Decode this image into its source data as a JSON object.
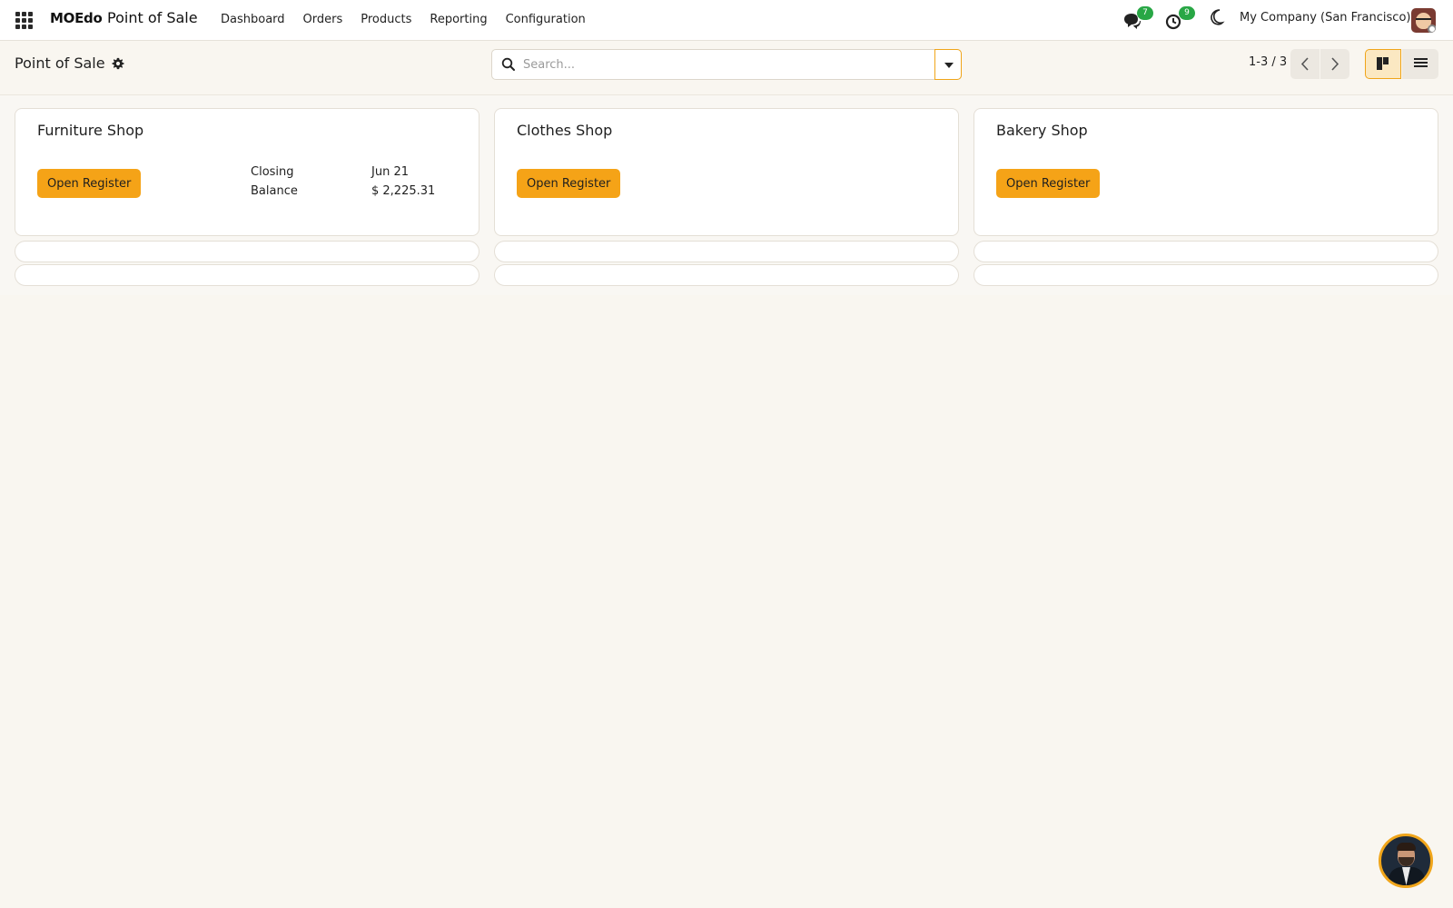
{
  "navbar": {
    "brand": "MOEdo",
    "app_name": "Point of Sale",
    "menu": [
      "Dashboard",
      "Orders",
      "Products",
      "Reporting",
      "Configuration"
    ],
    "messages_badge": "7",
    "activities_badge": "9",
    "company": "My Company (San Francisco)"
  },
  "control_panel": {
    "breadcrumb": "Point of Sale",
    "search_placeholder": "Search...",
    "pager": "1-3 / 3"
  },
  "cards": [
    {
      "title": "Furniture Shop",
      "button": "Open Register",
      "closing_label": "Closing",
      "closing_value": "Jun 21",
      "balance_label": "Balance",
      "balance_value": "$ 2,225.31"
    },
    {
      "title": "Clothes Shop",
      "button": "Open Register"
    },
    {
      "title": "Bakery Shop",
      "button": "Open Register"
    }
  ],
  "colors": {
    "accent": "#f5a317",
    "badge": "#28a745",
    "background": "#f9f6f0"
  }
}
